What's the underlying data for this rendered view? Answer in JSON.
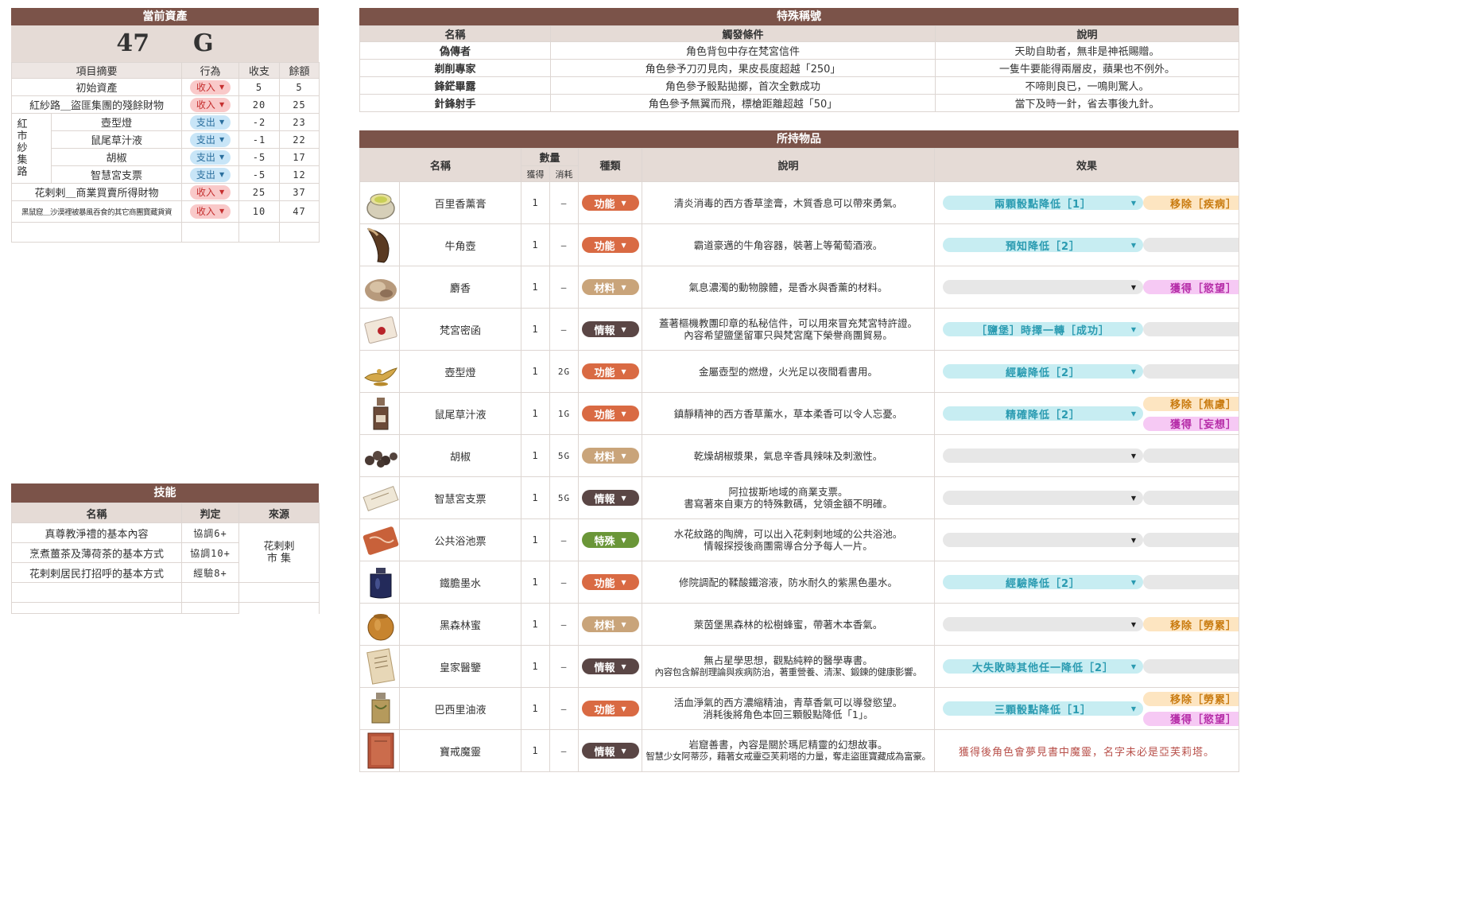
{
  "assets": {
    "title": "當前資產",
    "amount": "47",
    "unit": "G",
    "headers": [
      "項目摘要",
      "行為",
      "收支",
      "餘額"
    ],
    "group_label": "紅市紗集路",
    "rows": [
      {
        "summary": "初始資產",
        "action": "收入",
        "kind": "income",
        "change": "5",
        "balance": "5"
      },
      {
        "summary": "紅紗路＿盜匪集團的殘餘財物",
        "action": "收入",
        "kind": "income",
        "change": "20",
        "balance": "25"
      },
      {
        "summary": "壺型燈",
        "action": "支出",
        "kind": "expense",
        "change": "-2",
        "balance": "23"
      },
      {
        "summary": "鼠尾草汁液",
        "action": "支出",
        "kind": "expense",
        "change": "-1",
        "balance": "22"
      },
      {
        "summary": "胡椒",
        "action": "支出",
        "kind": "expense",
        "change": "-5",
        "balance": "17"
      },
      {
        "summary": "智慧宮支票",
        "action": "支出",
        "kind": "expense",
        "change": "-5",
        "balance": "12"
      },
      {
        "summary": "花剌剌＿商業買賣所得財物",
        "action": "收入",
        "kind": "income",
        "change": "25",
        "balance": "37"
      },
      {
        "summary": "黑鼠窟＿沙漠裡被暴風吞食的其它商團寶藏貨資",
        "action": "收入",
        "kind": "income",
        "change": "10",
        "balance": "47"
      }
    ]
  },
  "skills": {
    "title": "技能",
    "headers": [
      "名稱",
      "判定",
      "來源"
    ],
    "source": "花剌剌市 集",
    "rows": [
      {
        "name": "真尊教淨禮的基本內容",
        "check": "協調6+"
      },
      {
        "name": "烹煮薑茶及薄荷茶的基本方式",
        "check": "協調10+"
      },
      {
        "name": "花剌剌居民打招呼的基本方式",
        "check": "經驗8+"
      }
    ]
  },
  "titles": {
    "title": "特殊稱號",
    "headers": [
      "名稱",
      "觸發條件",
      "說明"
    ],
    "rows": [
      {
        "name": "偽傳者",
        "cond": "角色背包中存在梵宮信件",
        "desc": "天助自助者，無非是神祇賜贈。"
      },
      {
        "name": "剃削專家",
        "cond": "角色參予刀刃見肉，果皮長度超越「250」",
        "desc": "一隻牛要能得兩層皮，蘋果也不例外。"
      },
      {
        "name": "鋒鋩畢露",
        "cond": "角色參予骰點拋擲，首次全數成功",
        "desc": "不啼則良已，一鳴則驚人。"
      },
      {
        "name": "針鋒射手",
        "cond": "角色參予無翼而飛，標槍距離超越「50」",
        "desc": "當下及時一針，省去事後九針。"
      }
    ]
  },
  "inventory": {
    "title": "所持物品",
    "headers": {
      "name": "名稱",
      "qty": "數量",
      "got": "獲得",
      "used": "消耗",
      "type": "種類",
      "desc": "說明",
      "effect": "效果"
    },
    "items": [
      {
        "icon": "jar-icon",
        "name": "百里香薰膏",
        "got": "1",
        "used": "—",
        "type": "功能",
        "desc": [
          "清炎消毒的西方香草塗膏，木質香息可以帶來勇氣。"
        ],
        "eff1": {
          "text": "兩顆骰點降低［1］",
          "style": "cyan"
        },
        "eff2": [
          {
            "text": "移除［疾病］",
            "style": "orange"
          }
        ]
      },
      {
        "icon": "horn-icon",
        "name": "牛角壺",
        "got": "1",
        "used": "—",
        "type": "功能",
        "desc": [
          "霸道豪邁的牛角容器，裝著上等葡萄酒液。"
        ],
        "eff1": {
          "text": "預知降低［2］",
          "style": "cyan"
        },
        "eff2": [
          {
            "text": "",
            "style": "gray2"
          }
        ]
      },
      {
        "icon": "musk-icon",
        "name": "麝香",
        "got": "1",
        "used": "—",
        "type": "材料",
        "desc": [
          "氣息濃濁的動物腺體，是香水與香薰的材料。"
        ],
        "eff1": {
          "text": "",
          "style": "gray"
        },
        "eff2": [
          {
            "text": "獲得［慾望］",
            "style": "pink"
          }
        ]
      },
      {
        "icon": "letter-icon",
        "name": "梵宮密函",
        "got": "1",
        "used": "—",
        "type": "情報",
        "desc": [
          "蓋著樞機教團印章的私秘信件，可以用來冒充梵宮特許證。",
          "內容希望鹽堡留軍只與梵宮麾下榮譽商團貿易。"
        ],
        "eff1": {
          "text": "［鹽堡］時擇一轉［成功］",
          "style": "cyan"
        },
        "eff2": [
          {
            "text": "",
            "style": "gray2"
          }
        ]
      },
      {
        "icon": "lamp-icon",
        "name": "壺型燈",
        "got": "1",
        "used": "2G",
        "type": "功能",
        "desc": [
          "金屬壺型的燃燈，火光足以夜間看書用。"
        ],
        "eff1": {
          "text": "經驗降低［2］",
          "style": "cyan"
        },
        "eff2": [
          {
            "text": "",
            "style": "gray2"
          }
        ]
      },
      {
        "icon": "bottle-icon",
        "name": "鼠尾草汁液",
        "got": "1",
        "used": "1G",
        "type": "功能",
        "desc": [
          "鎮靜精神的西方香草薰水，草本柔香可以令人忘憂。"
        ],
        "eff1": {
          "text": "精確降低［2］",
          "style": "cyan"
        },
        "eff2": [
          {
            "text": "移除［焦慮］",
            "style": "orange"
          },
          {
            "text": "獲得［妄想］",
            "style": "pink"
          }
        ]
      },
      {
        "icon": "pepper-icon",
        "name": "胡椒",
        "got": "1",
        "used": "5G",
        "type": "材料",
        "desc": [
          "乾燥胡椒漿果，氣息辛香具辣味及刺激性。"
        ],
        "eff1": {
          "text": "",
          "style": "gray"
        },
        "eff2": [
          {
            "text": "",
            "style": "gray2"
          }
        ]
      },
      {
        "icon": "cheque-icon",
        "name": "智慧宮支票",
        "got": "1",
        "used": "5G",
        "type": "情報",
        "desc": [
          "阿拉拔斯地域的商業支票。",
          "書寫著來自東方的特殊數碼，兌領金額不明確。"
        ],
        "eff1": {
          "text": "",
          "style": "gray"
        },
        "eff2": [
          {
            "text": "",
            "style": "gray2"
          }
        ]
      },
      {
        "icon": "ticket-icon",
        "name": "公共浴池票",
        "got": "1",
        "used": "—",
        "type": "特殊",
        "desc": [
          "水花紋路的陶牌，可以出入花剌剌地域的公共浴池。",
          "情報探授後商團需導合分予每人一片。"
        ],
        "eff1": {
          "text": "",
          "style": "gray"
        },
        "eff2": [
          {
            "text": "",
            "style": "gray2"
          }
        ]
      },
      {
        "icon": "ink-icon",
        "name": "鐵膽墨水",
        "got": "1",
        "used": "—",
        "type": "功能",
        "desc": [
          "修院調配的鞣酸鐵溶液，防水耐久的紫黑色墨水。"
        ],
        "eff1": {
          "text": "經驗降低［2］",
          "style": "cyan"
        },
        "eff2": [
          {
            "text": "",
            "style": "gray2"
          }
        ]
      },
      {
        "icon": "honey-icon",
        "name": "黑森林蜜",
        "got": "1",
        "used": "—",
        "type": "材料",
        "desc": [
          "萊茵堡黑森林的松樹蜂蜜，帶著木本香氣。"
        ],
        "eff1": {
          "text": "",
          "style": "gray"
        },
        "eff2": [
          {
            "text": "移除［勞累］",
            "style": "orange"
          }
        ]
      },
      {
        "icon": "book-icon",
        "name": "皇家醫鑒",
        "got": "1",
        "used": "—",
        "type": "情報",
        "desc": [
          "無占星學思想，觀點純粹的醫學專書。",
          "內容包含解剖理論與疾病防治，著重營養、清潔、鍛鍊的健康影響。"
        ],
        "eff1": {
          "text": "大失敗時其他任一降低［2］",
          "style": "cyan"
        },
        "eff2": [
          {
            "text": "",
            "style": "gray2"
          }
        ]
      },
      {
        "icon": "oil-icon",
        "name": "巴西里油液",
        "got": "1",
        "used": "—",
        "type": "功能",
        "desc": [
          "活血淨氣的西方濃縮精油，青草香氣可以導發慾望。",
          "消耗後將角色本回三顆骰點降低「1」。"
        ],
        "eff1": {
          "text": "三顆骰點降低［1］",
          "style": "cyan"
        },
        "eff2": [
          {
            "text": "移除［勞累］",
            "style": "orange"
          },
          {
            "text": "獲得［慾望］",
            "style": "pink"
          }
        ]
      },
      {
        "icon": "tome-icon",
        "name": "寶戒魔靈",
        "got": "1",
        "used": "—",
        "type": "情報",
        "desc": [
          "岩窟善書，內容是關於瑪尼精靈的幻想故事。",
          "智慧少女阿蒂莎，藉著女戒靈亞芙莉塔的力量，奪走盜匪寶藏成為富豪。"
        ],
        "eff_text": "獲得後角色會夢見書中魔靈，名字未必是亞芙莉塔。"
      }
    ]
  },
  "colors": {
    "header": "#7b5349",
    "subheader": "#e5dbd6",
    "func": "#d96a43",
    "material": "#c9a47a",
    "intel": "#5a4645",
    "special": "#6a9638",
    "income_pill": "#f9c9c9",
    "expense_pill": "#c8e5f7"
  }
}
